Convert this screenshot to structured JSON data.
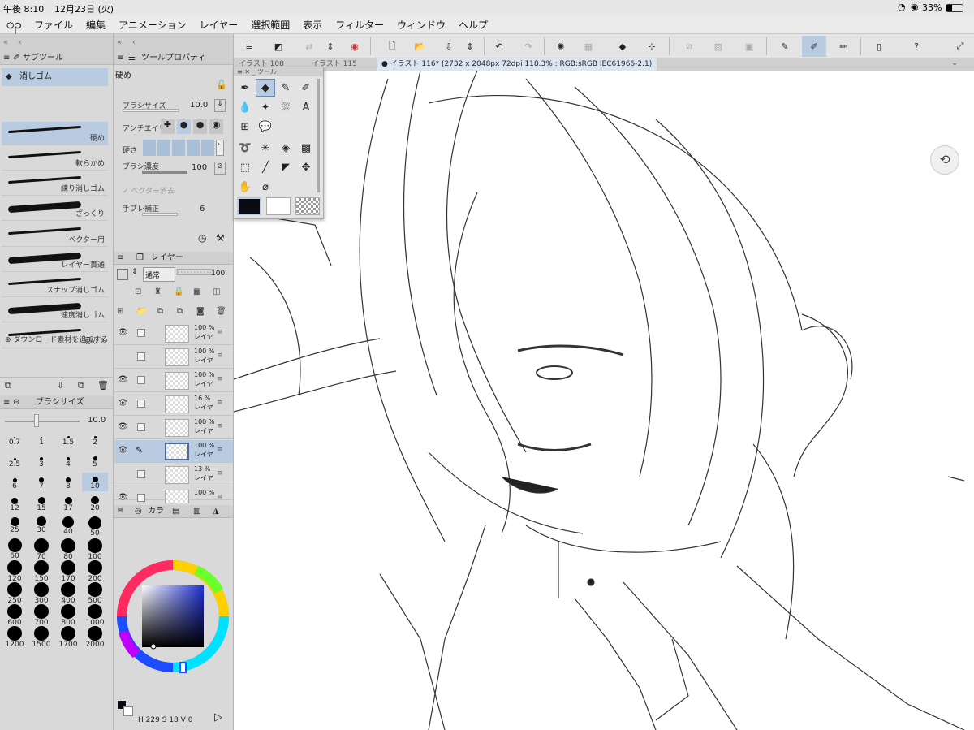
{
  "status": {
    "time": "午後 8:10",
    "date": "12月23日 (火)",
    "battery": "33%"
  },
  "menu": [
    "ファイル",
    "編集",
    "アニメーション",
    "レイヤー",
    "選択範囲",
    "表示",
    "フィルター",
    "ウィンドウ",
    "ヘルプ"
  ],
  "tabs": [
    {
      "label": "イラスト 108"
    },
    {
      "label": "イラスト 115"
    },
    {
      "label": "● イラスト 116* (2732 x 2048px 72dpi 118.3% : RGB:sRGB IEC61966-2.1)"
    }
  ],
  "subtool": {
    "title": "サブツール",
    "group": "消しゴム",
    "items": [
      "硬め",
      "軟らかめ",
      "練り消しゴム",
      "ざっくり",
      "ベクター用",
      "レイヤー貫通",
      "スナップ消しゴム",
      "速度消しゴム",
      "硬め 2"
    ],
    "download": "ダウンロード素材を追加する"
  },
  "toolprop": {
    "title": "ツールプロパティ",
    "name": "硬め",
    "brush_size_label": "ブラシサイズ",
    "brush_size": "10.0",
    "antialias_label": "アンチエイリ",
    "hardness_label": "硬さ",
    "density_label": "ブラシ濃度",
    "density": "100",
    "vector_label": "ベクター消去",
    "stabilize_label": "手ブレ補正",
    "stabilize": "6"
  },
  "brushsize": {
    "title": "ブラシサイズ",
    "value": "10.0",
    "cells": [
      "0.7",
      "1",
      "1.5",
      "2",
      "2.5",
      "3",
      "4",
      "5",
      "6",
      "7",
      "8",
      "10",
      "12",
      "15",
      "17",
      "20",
      "25",
      "30",
      "40",
      "50",
      "60",
      "70",
      "80",
      "100",
      "120",
      "150",
      "170",
      "200",
      "250",
      "300",
      "400",
      "500",
      "600",
      "700",
      "800",
      "1000",
      "1200",
      "1500",
      "1700",
      "2000"
    ],
    "selected": "10"
  },
  "layers": {
    "title": "レイヤー",
    "blend": "通常",
    "opacity": "100",
    "rows": [
      {
        "pct": "100 %",
        "name": "レイヤ"
      },
      {
        "pct": "100 %",
        "name": "レイヤ"
      },
      {
        "pct": "100 %",
        "name": "レイヤ"
      },
      {
        "pct": "16 %",
        "name": "レイヤ"
      },
      {
        "pct": "100 %",
        "name": "レイヤ"
      },
      {
        "pct": "100 %",
        "name": "レイヤ"
      },
      {
        "pct": "13 %",
        "name": "レイヤ"
      },
      {
        "pct": "100 %",
        "name": ""
      }
    ],
    "selected_index": 5
  },
  "color": {
    "tab": "カラ",
    "h": "229",
    "s": "18",
    "v": "0",
    "h_label": "H",
    "s_label": "S",
    "v_label": "V",
    "main_color": "#0a0a12"
  },
  "toolpalette": {
    "title": "ツール"
  },
  "colors": {
    "accent": "#b9cbe0",
    "panel": "#d9d9d9"
  }
}
